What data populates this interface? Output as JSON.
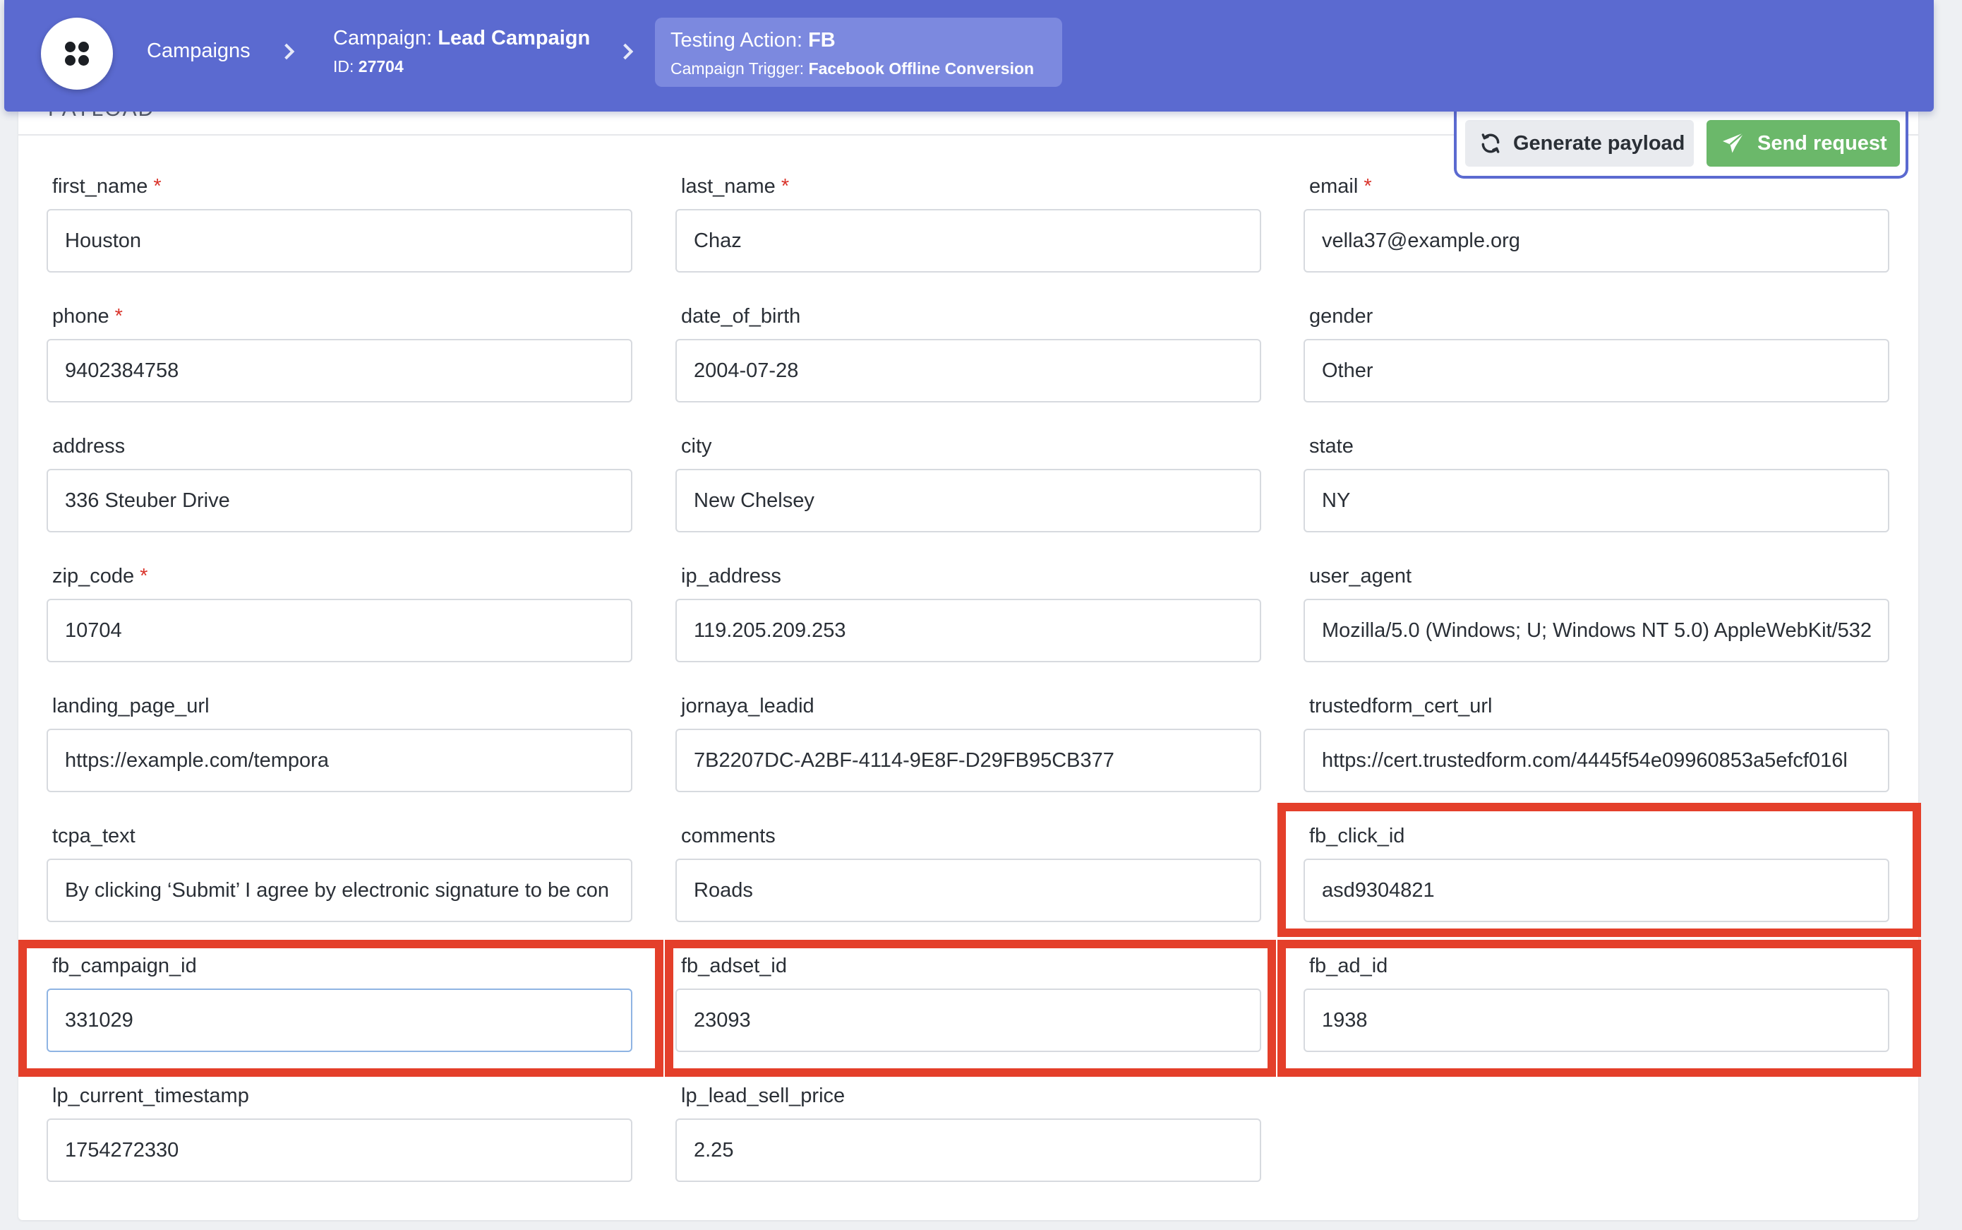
{
  "breadcrumb": {
    "campaigns_label": "Campaigns",
    "campaign_prefix": "Campaign:",
    "campaign_name": "Lead Campaign",
    "id_prefix": "ID:",
    "campaign_id": "27704",
    "testing_prefix": "Testing Action:",
    "testing_action": "FB",
    "trigger_prefix": "Campaign Trigger:",
    "trigger_name": "Facebook Offline Conversion"
  },
  "card": {
    "title": "PAYLOAD"
  },
  "actions": {
    "generate_label": "Generate payload",
    "send_label": "Send request",
    "accent_color": "#5b6ad0",
    "send_color": "#6bb86a",
    "highlight_color": "#e43f2a"
  },
  "fields": {
    "first_name": {
      "label": "first_name",
      "required": "*",
      "value": "Houston"
    },
    "last_name": {
      "label": "last_name",
      "required": "*",
      "value": "Chaz"
    },
    "email": {
      "label": "email",
      "required": "*",
      "value": "vella37@example.org"
    },
    "phone": {
      "label": "phone",
      "required": "*",
      "value": "9402384758"
    },
    "date_of_birth": {
      "label": "date_of_birth",
      "value": "2004-07-28"
    },
    "gender": {
      "label": "gender",
      "value": "Other"
    },
    "address": {
      "label": "address",
      "value": "336 Steuber Drive"
    },
    "city": {
      "label": "city",
      "value": "New Chelsey"
    },
    "state": {
      "label": "state",
      "value": "NY"
    },
    "zip_code": {
      "label": "zip_code",
      "required": "*",
      "value": "10704"
    },
    "ip_address": {
      "label": "ip_address",
      "value": "119.205.209.253"
    },
    "user_agent": {
      "label": "user_agent",
      "value": "Mozilla/5.0 (Windows; U; Windows NT 5.0) AppleWebKit/532"
    },
    "landing_page_url": {
      "label": "landing_page_url",
      "value": "https://example.com/tempora"
    },
    "jornaya_leadid": {
      "label": "jornaya_leadid",
      "value": "7B2207DC-A2BF-4114-9E8F-D29FB95CB377"
    },
    "trustedform_cert_url": {
      "label": "trustedform_cert_url",
      "value": "https://cert.trustedform.com/4445f54e09960853a5efcf016l"
    },
    "tcpa_text": {
      "label": "tcpa_text",
      "value": "By clicking ‘Submit’ I agree by electronic signature to be con"
    },
    "comments": {
      "label": "comments",
      "value": "Roads"
    },
    "fb_click_id": {
      "label": "fb_click_id",
      "value": "asd9304821"
    },
    "fb_campaign_id": {
      "label": "fb_campaign_id",
      "value": "331029"
    },
    "fb_adset_id": {
      "label": "fb_adset_id",
      "value": "23093"
    },
    "fb_ad_id": {
      "label": "fb_ad_id",
      "value": "1938"
    },
    "lp_current_timestamp": {
      "label": "lp_current_timestamp",
      "value": "1754272330"
    },
    "lp_lead_sell_price": {
      "label": "lp_lead_sell_price",
      "value": "2.25"
    }
  }
}
